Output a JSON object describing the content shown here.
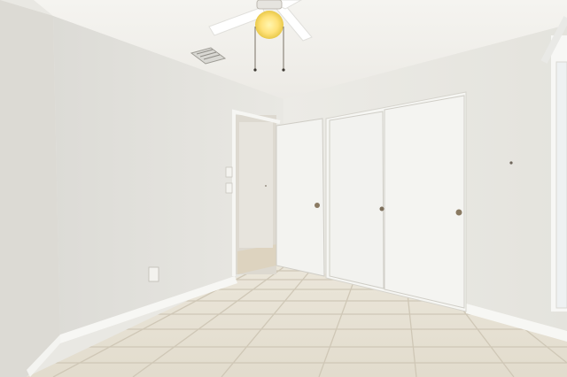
{
  "scene": {
    "kind": "empty bedroom interior photograph",
    "colors": {
      "ceiling": "#f4f3ef",
      "left_wall": "#e6e5e0",
      "back_wall": "#ecebe6",
      "right_wall": "#e3e2dc",
      "door": "#f3f3f0",
      "door_edge": "#cfcdc6",
      "baseboard": "#f7f7f4",
      "floor_tile": "#e6e0d2",
      "grout": "#cfc7b6",
      "light_glow": "#ffe98a",
      "knob": "#8a7a62"
    },
    "elements": [
      "ceiling-fan-with-light",
      "hvac-vent",
      "open-hallway-door",
      "light-switches",
      "wall-outlet",
      "sliding-closet-doors",
      "window",
      "tile-floor"
    ]
  }
}
